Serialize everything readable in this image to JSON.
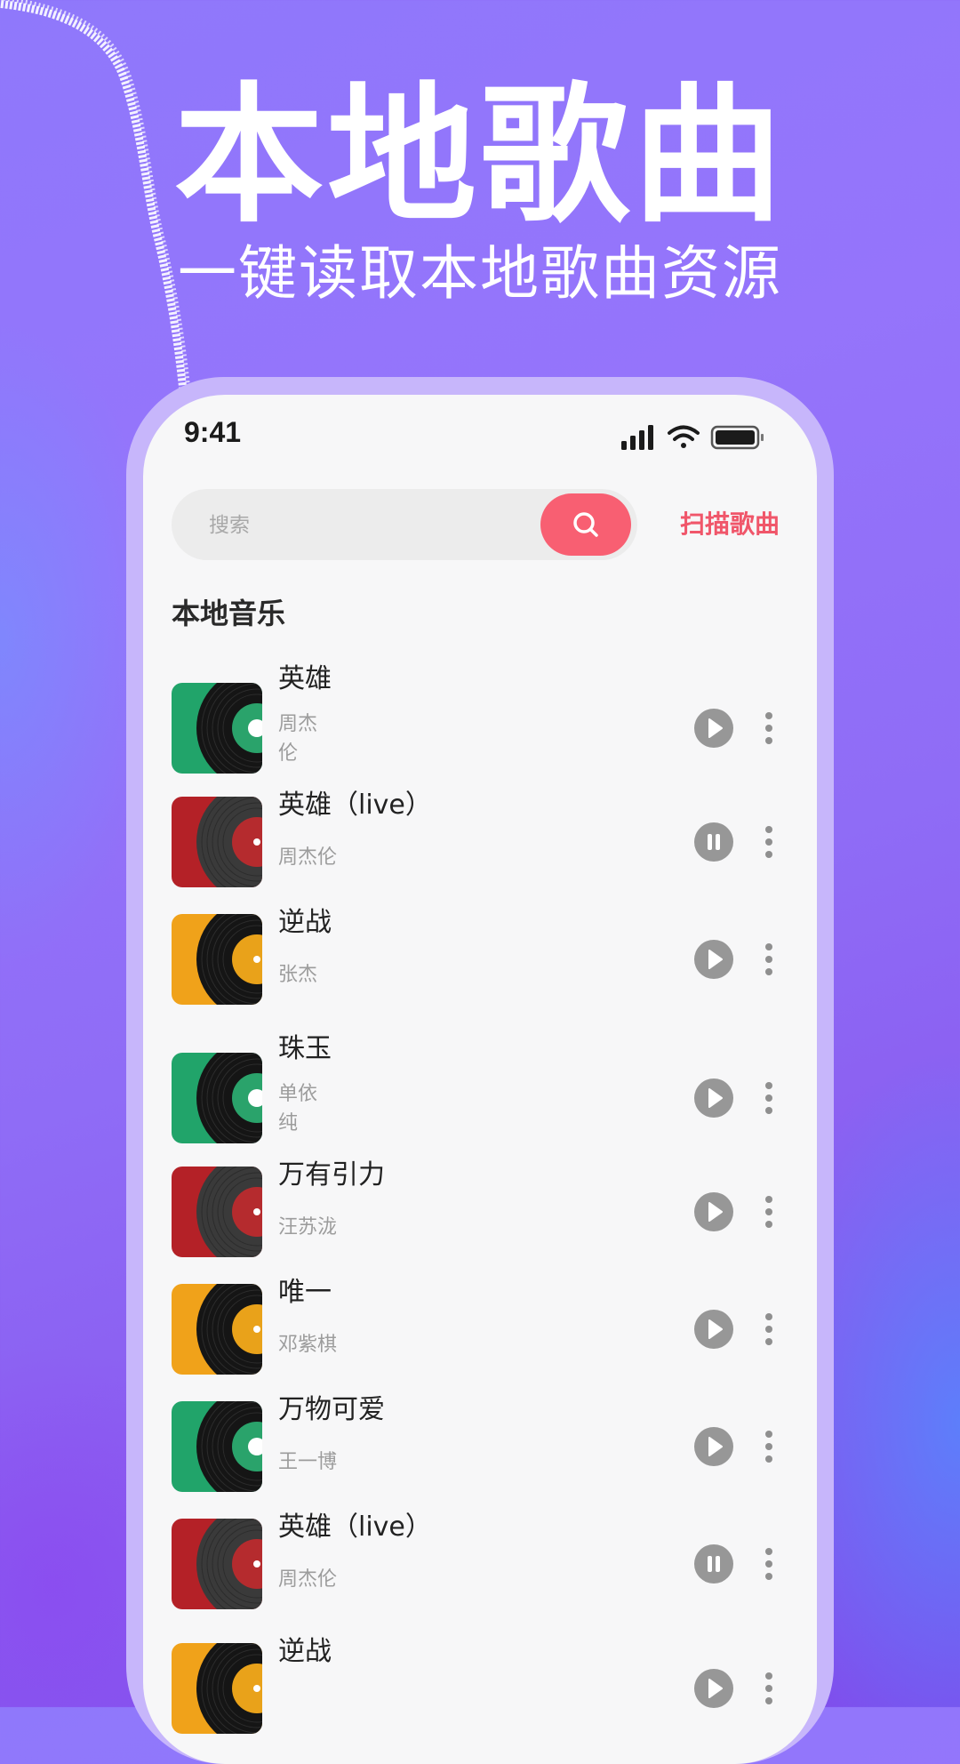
{
  "hero": {
    "title": "本地歌曲",
    "subtitle": "一键读取本地歌曲资源"
  },
  "status_bar": {
    "time": "9:41",
    "icons": [
      "signal-icon",
      "wifi-icon",
      "battery-icon"
    ]
  },
  "search": {
    "placeholder": "搜索",
    "value": "",
    "button_icon": "search-icon"
  },
  "scan_label": "扫描歌曲",
  "section_title": "本地音乐",
  "colors": {
    "accent": "#f85f72",
    "cover_green": "#21a46a",
    "cover_red": "#b42127",
    "cover_orange": "#f0a21a",
    "control_gray": "#979797"
  },
  "songs": [
    {
      "title": "英雄",
      "artist_lines": [
        "周杰",
        "伦"
      ],
      "state": "play",
      "cover": "green"
    },
    {
      "title": "英雄（live）",
      "artist_lines": [
        "周杰伦"
      ],
      "state": "pause",
      "cover": "red"
    },
    {
      "title": "逆战",
      "artist_lines": [
        "张杰"
      ],
      "state": "play",
      "cover": "orange"
    },
    {
      "title": "珠玉",
      "artist_lines": [
        "单依",
        "纯"
      ],
      "state": "play",
      "cover": "green"
    },
    {
      "title": "万有引力",
      "artist_lines": [
        "汪苏泷"
      ],
      "state": "play",
      "cover": "red"
    },
    {
      "title": "唯一",
      "artist_lines": [
        "邓紫棋"
      ],
      "state": "play",
      "cover": "orange"
    },
    {
      "title": "万物可爱",
      "artist_lines": [
        "王一博"
      ],
      "state": "play",
      "cover": "green"
    },
    {
      "title": "英雄（live）",
      "artist_lines": [
        "周杰伦"
      ],
      "state": "pause",
      "cover": "red"
    },
    {
      "title": "逆战",
      "artist_lines": [],
      "state": "play",
      "cover": "orange"
    }
  ]
}
